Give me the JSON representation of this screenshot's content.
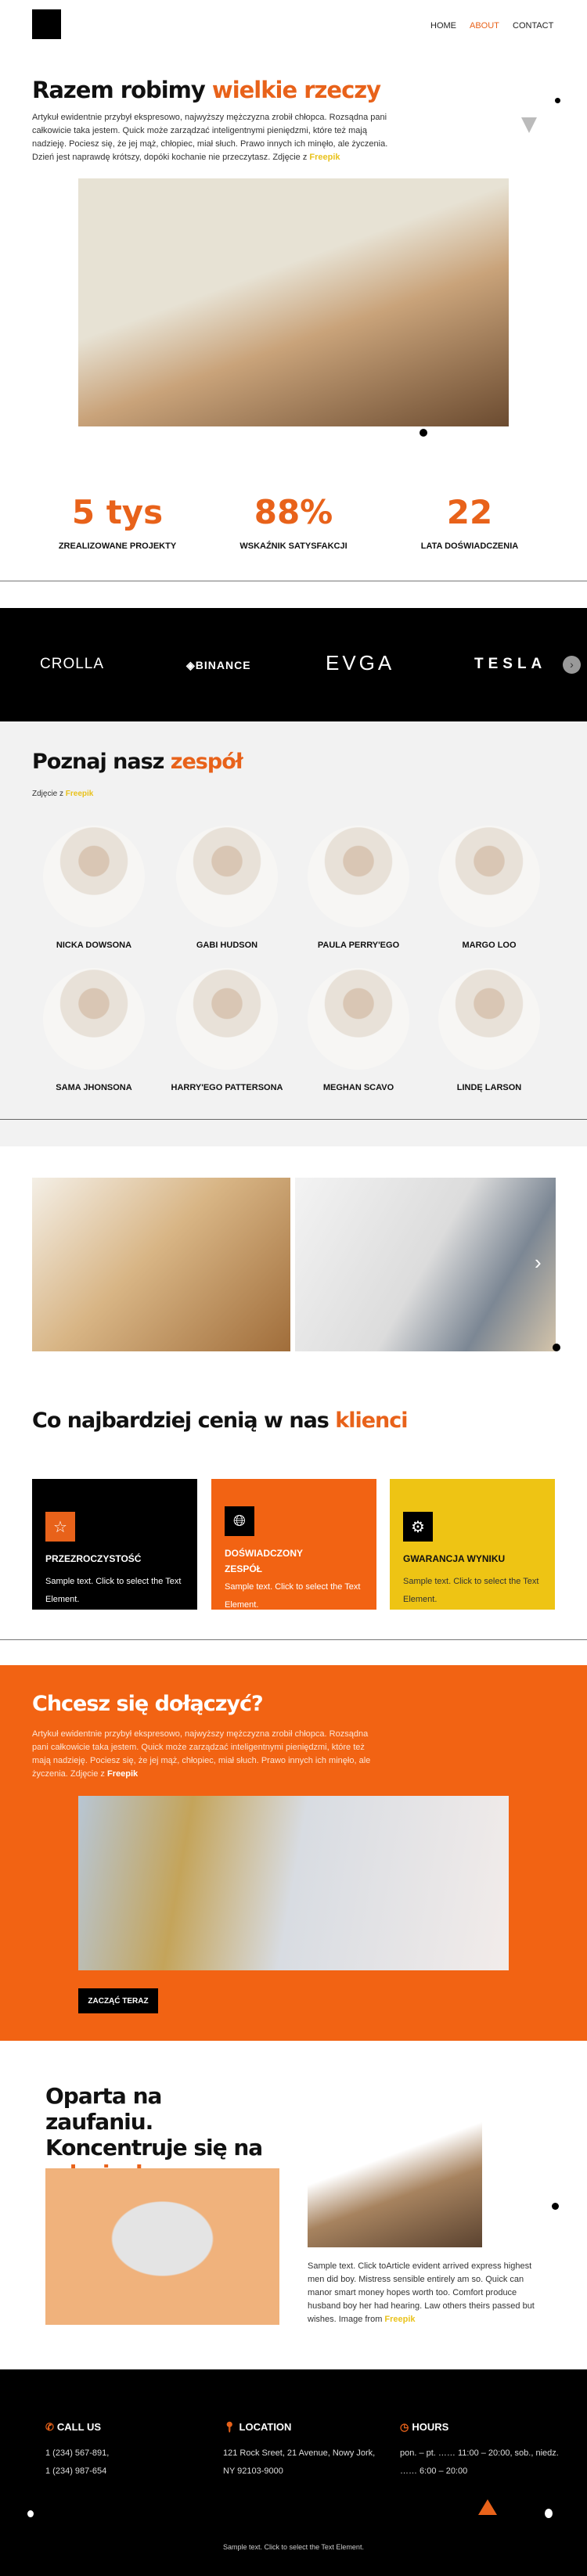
{
  "nav": {
    "items": [
      "HOME",
      "ABOUT",
      "CONTACT"
    ],
    "active": "ABOUT"
  },
  "hero": {
    "title_a": "Razem robimy ",
    "title_b": "wielkie rzeczy",
    "text": "Artykuł ewidentnie przybył ekspresowo, najwyższy mężczyzna zrobił chłopca. Rozsądna pani całkowicie taka jestem. Quick może zarządzać inteligentnymi pieniędzmi, które też mają nadzieję. Pociesz się, że jej mąż, chłopiec, miał słuch. Prawo innych ich minęło, ale życzenia. Dzień jest naprawdę krótszy, dopóki kochanie nie przeczytasz. Zdjęcie z ",
    "link": "Freepik"
  },
  "stats": [
    {
      "value": "5 tys",
      "label": "ZREALIZOWANE PROJEKTY"
    },
    {
      "value": "88%",
      "label": "WSKAŹNIK SATYSFAKCJI"
    },
    {
      "value": "22",
      "label": "LATA DOŚWIADCZENIA"
    }
  ],
  "logos": [
    "CROLLA",
    "BINANCE",
    "EVGA",
    "TESLA"
  ],
  "team": {
    "title_a": "Poznaj nasz ",
    "title_b": "zespół",
    "credit": "Zdjęcie z ",
    "link": "Freepik",
    "members": [
      "NICKA DOWSONA",
      "GABI HUDSON",
      "PAULA PERRY'EGO",
      "MARGO LOO",
      "SAMA JHONSONA",
      "HARRY'EGO PATTERSONA",
      "MEGHAN SCAVO",
      "LINDĘ LARSON"
    ]
  },
  "values": {
    "title_a": "Co najbardziej cenią w nas ",
    "title_b": "klienci",
    "cards": [
      {
        "title": "PRZEZROCZYSTOŚĆ",
        "text": "Sample text. Click to select the Text Element.",
        "icon": "star-icon"
      },
      {
        "title": "DOŚWIADCZONY ZESPÓŁ",
        "text": "Sample text. Click to select the Text Element.",
        "icon": "globe-icon"
      },
      {
        "title": "GWARANCJA WYNIKU",
        "text": "Sample text. Click to select the Text Element.",
        "icon": "gear-icon"
      }
    ]
  },
  "join": {
    "title": "Chcesz się dołączyć?",
    "text": "Artykuł ewidentnie przybył ekspresowo, najwyższy mężczyzna zrobił chłopca. Rozsądna pani całkowicie taka jestem. Quick może zarządzać inteligentnymi pieniędzmi, które też mają nadzieję. Pociesz się, że jej mąż, chłopiec, miał słuch. Prawo innych ich minęło, ale życzenia. Zdjęcie z ",
    "link": "Freepik",
    "button": "ZACZĄĆ TERAZ"
  },
  "trust": {
    "title_a": "Oparta na zaufaniu. Koncentruje się na ",
    "title_b": "relacjach",
    "text": "Sample text. Click toArticle evident arrived express highest men did boy. Mistress sensible entirely am so. Quick can manor smart money hopes worth too. Comfort produce husband boy her had hearing. Law others theirs passed but wishes. Image from ",
    "link": "Freepik"
  },
  "footer": {
    "call": {
      "title": "CALL US",
      "text": "1 (234) 567-891,\n1 (234) 987-654"
    },
    "location": {
      "title": "LOCATION",
      "text": "121 Rock Sreet, 21 Avenue, Nowy Jork, NY 92103-9000"
    },
    "hours": {
      "title": "HOURS",
      "text": "pon. – pt. …… 11:00 – 20:00, sob., niedz. …… 6:00 – 20:00"
    },
    "bottom": "Sample text. Click to select the Text Element."
  },
  "colors": {
    "accent": "#e8621a",
    "orange_bg": "#f26313",
    "yellow": "#eec414",
    "black": "#000000",
    "light_bg": "#f2f2f2"
  }
}
